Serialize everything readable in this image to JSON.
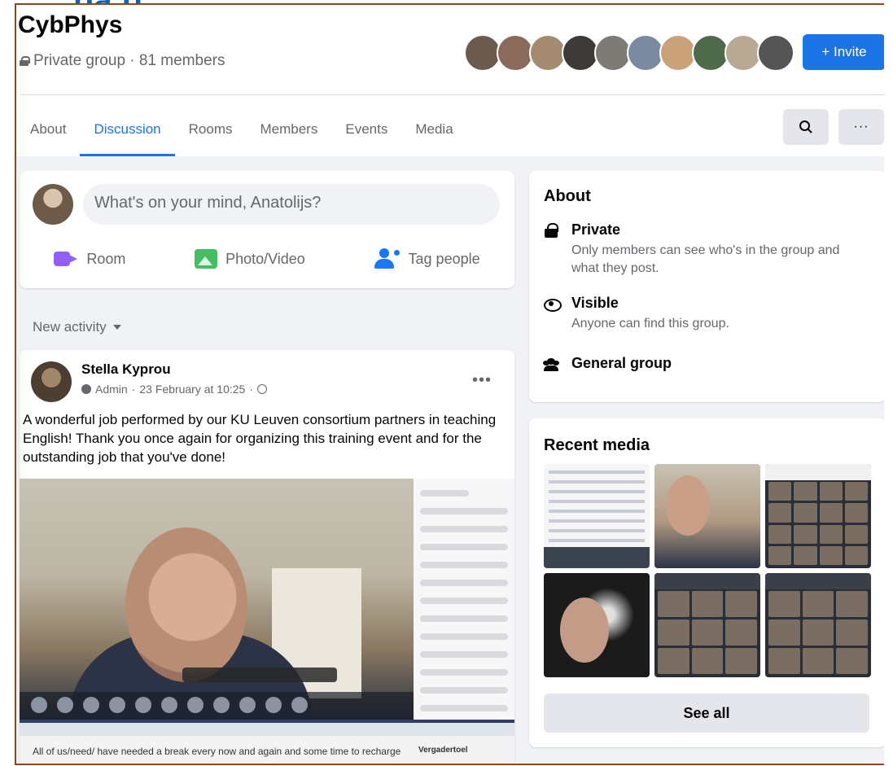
{
  "group": {
    "name": "CybPhys",
    "meta": "Private group · 81 members",
    "invite_label": "+ Invite"
  },
  "member_avatars": [
    "#6b5b4e",
    "#8a6a5a",
    "#a58a72",
    "#3d3a38",
    "#7e7a76",
    "#7a8aa0",
    "#c9a27a",
    "#4f6a4a",
    "#b8a894",
    "#555555"
  ],
  "tabs": [
    "About",
    "Discussion",
    "Rooms",
    "Members",
    "Events",
    "Media"
  ],
  "active_tab": "Discussion",
  "tab_buttons": {
    "search_icon": "search-icon",
    "more_icon": "more-icon"
  },
  "composer": {
    "placeholder": "What's on your mind, Anatolijs?",
    "actions": {
      "room": "Room",
      "photo": "Photo/Video",
      "tag": "Tag people"
    }
  },
  "feed_sort": "New activity",
  "post": {
    "author": "Stella Kyprou",
    "role": "Admin",
    "timestamp": "23 February at 10:25",
    "text": "A wonderful job performed by our KU Leuven consortium partners in teaching English! Thank you once again for organizing this training event and for the outstanding job that you've done!",
    "screenshot_caption": "All of us/need/ have needed a break every now and again and some time to recharge",
    "screenshot_panel": "Vergadertoel"
  },
  "about": {
    "title": "About",
    "private_title": "Private",
    "private_desc": "Only members can see who's in the group and what they post.",
    "visible_title": "Visible",
    "visible_desc": "Anyone can find this group.",
    "general_title": "General group"
  },
  "recent_media": {
    "title": "Recent media",
    "see_all": "See all"
  },
  "colors": {
    "accent": "#1b74e4",
    "page_bg": "#f0f2f5",
    "frame": "#8a4a1c"
  }
}
